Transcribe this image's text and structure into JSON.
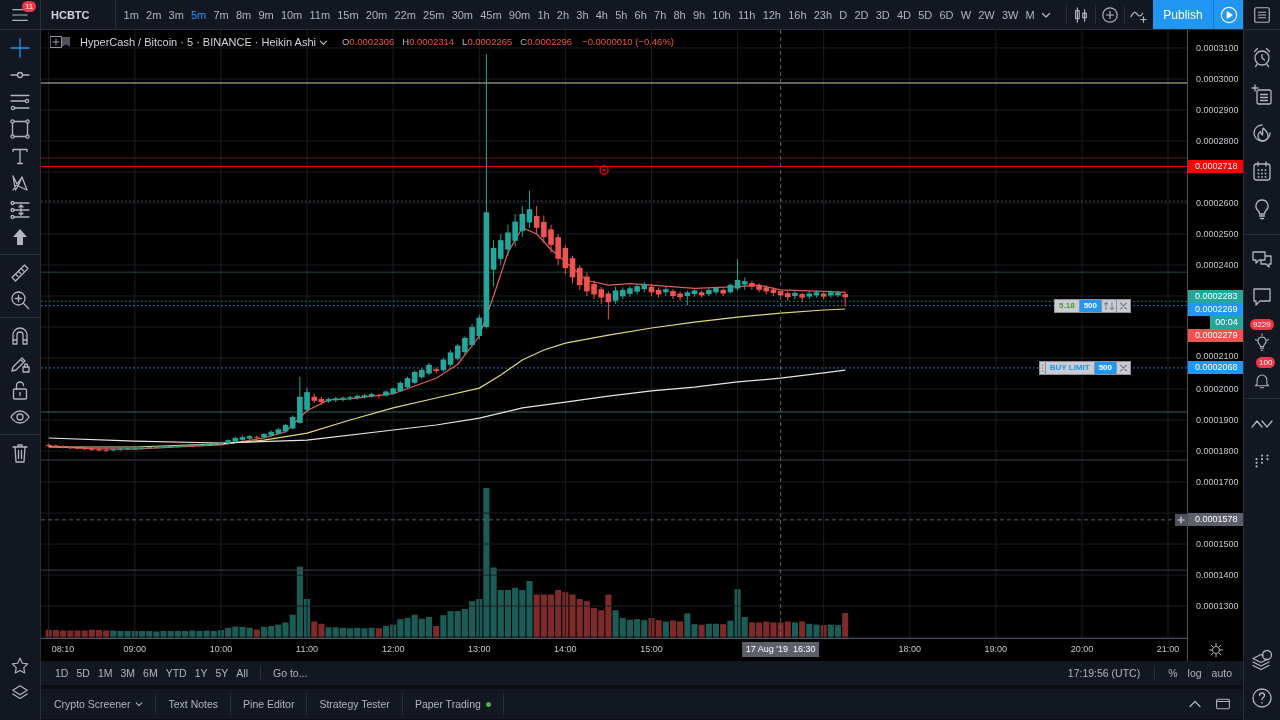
{
  "top_bar": {
    "menu_badge": "11",
    "symbol": "HCBTC",
    "intervals": [
      {
        "label": "1m",
        "selected": false
      },
      {
        "label": "2m",
        "selected": false
      },
      {
        "label": "3m",
        "selected": false
      },
      {
        "label": "5m",
        "selected": true
      },
      {
        "label": "7m",
        "selected": false
      },
      {
        "label": "8m",
        "selected": false
      },
      {
        "label": "9m",
        "selected": false
      },
      {
        "label": "10m",
        "selected": false
      },
      {
        "label": "11m",
        "selected": false
      },
      {
        "label": "15m",
        "selected": false
      },
      {
        "label": "20m",
        "selected": false
      },
      {
        "label": "22m",
        "selected": false
      },
      {
        "label": "25m",
        "selected": false
      },
      {
        "label": "30m",
        "selected": false
      },
      {
        "label": "45m",
        "selected": false
      },
      {
        "label": "90m",
        "selected": false
      },
      {
        "label": "1h",
        "selected": false
      },
      {
        "label": "2h",
        "selected": false
      },
      {
        "label": "3h",
        "selected": false
      },
      {
        "label": "4h",
        "selected": false
      },
      {
        "label": "5h",
        "selected": false
      },
      {
        "label": "6h",
        "selected": false
      },
      {
        "label": "7h",
        "selected": false
      },
      {
        "label": "8h",
        "selected": false
      },
      {
        "label": "9h",
        "selected": false
      },
      {
        "label": "10h",
        "selected": false
      },
      {
        "label": "11h",
        "selected": false
      },
      {
        "label": "12h",
        "selected": false
      },
      {
        "label": "16h",
        "selected": false
      },
      {
        "label": "23h",
        "selected": false
      },
      {
        "label": "D",
        "selected": false
      },
      {
        "label": "2D",
        "selected": false
      },
      {
        "label": "3D",
        "selected": false
      },
      {
        "label": "4D",
        "selected": false
      },
      {
        "label": "5D",
        "selected": false
      },
      {
        "label": "6D",
        "selected": false
      },
      {
        "label": "W",
        "selected": false
      },
      {
        "label": "2W",
        "selected": false
      },
      {
        "label": "3W",
        "selected": false
      },
      {
        "label": "M",
        "selected": false
      }
    ],
    "publish": "Publish"
  },
  "left_toolbar": {
    "tools": [
      {
        "selected": true
      },
      {
        "selected": false
      },
      {
        "selected": false
      },
      {
        "selected": false
      },
      {
        "selected": false
      },
      {
        "selected": false
      },
      {
        "selected": false
      },
      {
        "selected": false
      },
      {
        "selected": false
      },
      {
        "selected": false
      },
      {
        "selected": false
      },
      {
        "selected": false
      },
      {
        "selected": false
      },
      {
        "selected": false
      },
      {
        "selected": false
      }
    ]
  },
  "chart": {
    "legend": {
      "title": "HyperCash / Bitcoin · 5 · BINANCE · Heikin Ashi",
      "ohlc": [
        {
          "label": "O",
          "value": "0.0002306"
        },
        {
          "label": "H",
          "value": "0.0002314"
        },
        {
          "label": "L",
          "value": "0.0002265"
        },
        {
          "label": "C",
          "value": "0.0002296"
        }
      ],
      "change": "−0.0000010 (−0.46%)"
    },
    "line_widgets": [
      {
        "kind": "countdown",
        "text": "00:04"
      },
      {
        "kind": "position",
        "pnl": "5.18",
        "qty": "500"
      },
      {
        "kind": "order",
        "label": "BUY LIMIT",
        "qty": "500"
      }
    ],
    "price_tags": [
      {
        "price": "0.0002279",
        "color": "#ef5350"
      }
    ],
    "chart_data": [
      {
        "type": "candlestick",
        "x": [
          8,
          8.0833,
          8.1667,
          8.25,
          8.3333,
          8.4167,
          8.5,
          8.5833,
          8.6667,
          8.75,
          8.8333,
          8.9167,
          9,
          9.0833,
          9.1667,
          9.25,
          9.3333,
          9.4167,
          9.5,
          9.5833,
          9.6667,
          9.75,
          9.8333,
          9.9167,
          10,
          10.0833,
          10.1667,
          10.25,
          10.3333,
          10.4167,
          10.5,
          10.5833,
          10.6667,
          10.75,
          10.8333,
          10.9167,
          11,
          11.0833,
          11.1667,
          11.25,
          11.3333,
          11.4167,
          11.5,
          11.5833,
          11.6667,
          11.75,
          11.8333,
          11.9167,
          12,
          12.0833,
          12.1667,
          12.25,
          12.3333,
          12.4167,
          12.5,
          12.5833,
          12.6667,
          12.75,
          12.8333,
          12.9167,
          13,
          13.0833,
          13.1667,
          13.25,
          13.3333,
          13.4167,
          13.5,
          13.5833,
          13.6667,
          13.75,
          13.8333,
          13.9167,
          14,
          14.0833,
          14.1667,
          14.25,
          14.3333,
          14.4167,
          14.5,
          14.5833,
          14.6667,
          14.75,
          14.8333,
          14.9167,
          15,
          15.0833,
          15.1667,
          15.25,
          15.3333,
          15.4167,
          15.5,
          15.5833,
          15.6667,
          15.75,
          15.8333,
          15.9167,
          16,
          16.0833,
          16.1667,
          16.25,
          16.3333,
          16.4167,
          16.5,
          16.5833,
          16.6667,
          16.75,
          16.8333,
          16.9167,
          17,
          17.0833,
          17.1667,
          17.25
        ],
        "ohlc": [
          [
            0.000182,
            0.0001824,
            0.0001812,
            0.0001816
          ],
          [
            0.0001818,
            0.0001821,
            0.000181,
            0.0001813
          ],
          [
            0.0001815,
            0.0001818,
            0.0001808,
            0.0001811
          ],
          [
            0.0001813,
            0.0001816,
            0.0001806,
            0.0001809
          ],
          [
            0.0001811,
            0.0001815,
            0.0001805,
            0.0001808
          ],
          [
            0.000181,
            0.0001813,
            0.0001803,
            0.0001806
          ],
          [
            0.0001808,
            0.0001812,
            0.00018,
            0.0001804
          ],
          [
            0.0001806,
            0.000181,
            0.0001799,
            0.0001802
          ],
          [
            0.0001804,
            0.0001808,
            0.0001798,
            0.0001801
          ],
          [
            0.0001802,
            0.0001809,
            0.0001799,
            0.0001806
          ],
          [
            0.0001804,
            0.000181,
            0.0001801,
            0.0001808
          ],
          [
            0.0001806,
            0.0001812,
            0.0001803,
            0.000181
          ],
          [
            0.0001808,
            0.0001813,
            0.0001804,
            0.0001809
          ],
          [
            0.0001808,
            0.0001814,
            0.0001805,
            0.0001811
          ],
          [
            0.000181,
            0.0001815,
            0.0001806,
            0.0001812
          ],
          [
            0.0001811,
            0.0001816,
            0.0001808,
            0.0001814
          ],
          [
            0.0001812,
            0.0001818,
            0.0001809,
            0.0001815
          ],
          [
            0.0001814,
            0.0001819,
            0.000181,
            0.0001816
          ],
          [
            0.0001815,
            0.000182,
            0.0001811,
            0.0001817
          ],
          [
            0.0001816,
            0.0001821,
            0.0001812,
            0.0001818
          ],
          [
            0.0001817,
            0.0001823,
            0.0001813,
            0.000182
          ],
          [
            0.0001818,
            0.0001824,
            0.0001815,
            0.0001821
          ],
          [
            0.000182,
            0.0001826,
            0.0001816,
            0.0001823
          ],
          [
            0.0001821,
            0.0001827,
            0.0001818,
            0.0001824
          ],
          [
            0.0001823,
            0.000183,
            0.0001819,
            0.0001828
          ],
          [
            0.0001825,
            0.0001838,
            0.0001822,
            0.0001835
          ],
          [
            0.000183,
            0.0001846,
            0.0001827,
            0.0001842
          ],
          [
            0.0001836,
            0.000185,
            0.0001832,
            0.0001845
          ],
          [
            0.000184,
            0.0001852,
            0.0001836,
            0.0001848
          ],
          [
            0.0001846,
            0.000185,
            0.0001838,
            0.0001843
          ],
          [
            0.0001844,
            0.0001858,
            0.000184,
            0.0001855
          ],
          [
            0.000185,
            0.0001866,
            0.0001846,
            0.0001862
          ],
          [
            0.0001856,
            0.0001875,
            0.0001852,
            0.000187
          ],
          [
            0.0001863,
            0.0001888,
            0.000186,
            0.0001884
          ],
          [
            0.0001873,
            0.0001915,
            0.000187,
            0.000191
          ],
          [
            0.0001891,
            0.000204,
            0.0001888,
            0.0001975
          ],
          [
            0.0001933,
            0.0002005,
            0.0001925,
            0.000199
          ],
          [
            0.0001975,
            0.0001985,
            0.0001955,
            0.0001962
          ],
          [
            0.0001968,
            0.0001975,
            0.000195,
            0.0001958
          ],
          [
            0.000196,
            0.0001972,
            0.0001955,
            0.0001968
          ],
          [
            0.0001964,
            0.0001975,
            0.0001958,
            0.000197
          ],
          [
            0.0001967,
            0.0001976,
            0.000196,
            0.0001972
          ],
          [
            0.0001969,
            0.0001978,
            0.0001963,
            0.0001974
          ],
          [
            0.0001971,
            0.0001982,
            0.0001966,
            0.0001978
          ],
          [
            0.0001974,
            0.0001984,
            0.0001969,
            0.000198
          ],
          [
            0.0001977,
            0.0001988,
            0.0001972,
            0.0001984
          ],
          [
            0.0001981,
            0.0001985,
            0.000197,
            0.0001978
          ],
          [
            0.0001979,
            0.0001995,
            0.0001975,
            0.0001992
          ],
          [
            0.0001985,
            0.0002005,
            0.0001982,
            0.0002002
          ],
          [
            0.0001993,
            0.0002025,
            0.000199,
            0.000202
          ],
          [
            0.0002006,
            0.000204,
            0.0002002,
            0.0002035
          ],
          [
            0.000202,
            0.000206,
            0.0002015,
            0.0002055
          ],
          [
            0.0002038,
            0.0002068,
            0.0002032,
            0.0002062
          ],
          [
            0.000205,
            0.0002085,
            0.0002045,
            0.0002078
          ],
          [
            0.0002064,
            0.000207,
            0.000205,
            0.0002058
          ],
          [
            0.0002061,
            0.00021,
            0.0002056,
            0.0002095
          ],
          [
            0.0002078,
            0.0002125,
            0.0002072,
            0.0002118
          ],
          [
            0.0002098,
            0.0002145,
            0.0002092,
            0.000214
          ],
          [
            0.0002119,
            0.000217,
            0.0002112,
            0.0002165
          ],
          [
            0.0002142,
            0.000221,
            0.0002135,
            0.00022
          ],
          [
            0.0002171,
            0.000224,
            0.000216,
            0.000223
          ],
          [
            0.00022,
            0.000308,
            0.0002195,
            0.000257
          ],
          [
            0.0002385,
            0.000248,
            0.000233,
            0.0002455
          ],
          [
            0.000242,
            0.00025,
            0.00024,
            0.000248
          ],
          [
            0.000245,
            0.000253,
            0.000243,
            0.0002505
          ],
          [
            0.0002478,
            0.0002565,
            0.000246,
            0.000254
          ],
          [
            0.0002509,
            0.000259,
            0.000249,
            0.0002565
          ],
          [
            0.0002537,
            0.000264,
            0.000252,
            0.000258
          ],
          [
            0.0002558,
            0.000259,
            0.00025,
            0.000252
          ],
          [
            0.0002539,
            0.000256,
            0.000247,
            0.000249
          ],
          [
            0.0002515,
            0.000253,
            0.000244,
            0.0002465
          ],
          [
            0.000249,
            0.00025,
            0.00024,
            0.000242
          ],
          [
            0.0002455,
            0.0002465,
            0.000237,
            0.000239
          ],
          [
            0.0002422,
            0.000243,
            0.000234,
            0.000236
          ],
          [
            0.0002391,
            0.00024,
            0.000232,
            0.0002335
          ],
          [
            0.0002363,
            0.0002375,
            0.00023,
            0.0002315
          ],
          [
            0.0002339,
            0.000235,
            0.000229,
            0.0002305
          ],
          [
            0.0002322,
            0.000233,
            0.0002275,
            0.0002295
          ],
          [
            0.0002308,
            0.0002315,
            0.0002225,
            0.000228
          ],
          [
            0.0002285,
            0.000233,
            0.0002275,
            0.0002318
          ],
          [
            0.0002299,
            0.0002328,
            0.000229,
            0.000232
          ],
          [
            0.0002307,
            0.0002332,
            0.0002298,
            0.0002325
          ],
          [
            0.0002314,
            0.000234,
            0.0002305,
            0.0002332
          ],
          [
            0.0002322,
            0.0002345,
            0.0002312,
            0.0002338
          ],
          [
            0.000233,
            0.0002338,
            0.00023,
            0.0002312
          ],
          [
            0.000232,
            0.0002328,
            0.0002295,
            0.0002305
          ],
          [
            0.0002312,
            0.000233,
            0.00023,
            0.0002322
          ],
          [
            0.0002316,
            0.0002322,
            0.000229,
            0.00023
          ],
          [
            0.0002308,
            0.0002315,
            0.0002285,
            0.0002296
          ],
          [
            0.00023,
            0.0002318,
            0.000227,
            0.0002312
          ],
          [
            0.0002306,
            0.0002322,
            0.0002298,
            0.0002318
          ],
          [
            0.0002312,
            0.0002318,
            0.0002295,
            0.0002302
          ],
          [
            0.0002306,
            0.0002325,
            0.00023,
            0.000232
          ],
          [
            0.0002312,
            0.000233,
            0.0002305,
            0.0002326
          ],
          [
            0.000232,
            0.0002324,
            0.00023,
            0.0002308
          ],
          [
            0.0002312,
            0.000234,
            0.0002308,
            0.0002336
          ],
          [
            0.0002324,
            0.000242,
            0.0002318,
            0.0002352
          ],
          [
            0.0002337,
            0.000236,
            0.000232,
            0.0002348
          ],
          [
            0.0002342,
            0.0002348,
            0.000232,
            0.000233
          ],
          [
            0.0002335,
            0.000234,
            0.0002312,
            0.000232
          ],
          [
            0.0002328,
            0.0002335,
            0.0002305,
            0.0002315
          ],
          [
            0.0002321,
            0.0002328,
            0.00023,
            0.000231
          ],
          [
            0.0002316,
            0.000232,
            0.0002292,
            0.0002302
          ],
          [
            0.0002309,
            0.0002315,
            0.0002285,
            0.0002296
          ],
          [
            0.00023,
            0.0002318,
            0.000229,
            0.000231
          ],
          [
            0.0002306,
            0.000231,
            0.000228,
            0.0002295
          ],
          [
            0.0002298,
            0.0002315,
            0.000229,
            0.0002308
          ],
          [
            0.0002302,
            0.0002318,
            0.0002295,
            0.0002312
          ],
          [
            0.0002308,
            0.0002312,
            0.000229,
            0.0002298
          ],
          [
            0.0002302,
            0.0002318,
            0.0002295,
            0.0002312
          ],
          [
            0.0002302,
            0.0002318,
            0.0002296,
            0.0002312
          ],
          [
            0.0002306,
            0.0002314,
            0.0002265,
            0.0002296
          ]
        ],
        "series": [
          {
            "type": "line",
            "color": "#e35d5d",
            "x": [
              8,
              8.5,
              9,
              9.5,
              10,
              10.5,
              10.75,
              11,
              11.25,
              11.5,
              12,
              12.5,
              12.75,
              13,
              13.1667,
              13.3333,
              13.5,
              13.6667,
              13.8333,
              14,
              14.25,
              14.5,
              14.75,
              15,
              15.5,
              16,
              16.25,
              16.5,
              17,
              17.25
            ],
            "values": [
              0.0001815,
              0.0001808,
              0.0001806,
              0.0001813,
              0.000182,
              0.0001842,
              0.0001862,
              0.000193,
              0.0001965,
              0.0001968,
              0.0001985,
              0.0002035,
              0.000208,
              0.000217,
              0.00023,
              0.000244,
              0.000252,
              0.00025,
              0.000245,
              0.000241,
              0.000235,
              0.0002335,
              0.000234,
              0.0002335,
              0.0002325,
              0.000233,
              0.0002335,
              0.000232,
              0.0002315,
              0.0002312
            ]
          },
          {
            "type": "line",
            "color": "#e3d77a",
            "x": [
              8,
              9,
              10,
              10.5,
              11,
              11.5,
              12,
              12.5,
              13,
              13.25,
              13.5,
              13.75,
              14,
              14.5,
              15,
              15.5,
              16,
              16.5,
              17,
              17.25
            ],
            "values": [
              0.0001813,
              0.0001813,
              0.0001823,
              0.0001835,
              0.0001858,
              0.00019,
              0.0001939,
              0.0001971,
              0.0002003,
              0.0002045,
              0.0002094,
              0.0002126,
              0.0002148,
              0.0002174,
              0.0002197,
              0.0002216,
              0.0002232,
              0.0002245,
              0.0002255,
              0.0002258
            ]
          },
          {
            "type": "line",
            "color": "#e8e6df",
            "x": [
              8,
              9,
              10,
              11,
              12,
              12.5,
              13,
              13.5,
              14,
              14.5,
              15,
              15.5,
              16,
              16.5,
              17,
              17.25
            ],
            "values": [
              0.0001842,
              0.0001832,
              0.0001826,
              0.0001835,
              0.0001868,
              0.0001884,
              0.0001906,
              0.0001939,
              0.0001958,
              0.0001977,
              0.0001994,
              0.0002006,
              0.0002023,
              0.0002035,
              0.0002052,
              0.0002061
            ]
          }
        ],
        "xlim": [
          7.91,
          21.22
        ],
        "ylim": [
          0.0001197,
          0.0003158
        ],
        "xticks": [
          {
            "value": 8.1667,
            "label": "08:10"
          },
          {
            "value": 9,
            "label": "09:00"
          },
          {
            "value": 10,
            "label": "10:00"
          },
          {
            "value": 11,
            "label": "11:00"
          },
          {
            "value": 12,
            "label": "12:00"
          },
          {
            "value": 13,
            "label": "13:00"
          },
          {
            "value": 14,
            "label": "14:00"
          },
          {
            "value": 15,
            "label": "15:00"
          },
          {
            "value": 18,
            "label": "18:00"
          },
          {
            "value": 19,
            "label": "19:00"
          },
          {
            "value": 20,
            "label": "20:00"
          },
          {
            "value": 21,
            "label": "21:00"
          }
        ],
        "yticks": [
          {
            "value": 0.00013,
            "label": "0.0001300"
          },
          {
            "value": 0.00014,
            "label": "0.0001400"
          },
          {
            "value": 0.00015,
            "label": "0.0001500"
          },
          {
            "value": 0.00017,
            "label": "0.0001700"
          },
          {
            "value": 0.00018,
            "label": "0.0001800"
          },
          {
            "value": 0.00019,
            "label": "0.0001900"
          },
          {
            "value": 0.0002,
            "label": "0.0002000"
          },
          {
            "value": 0.00021,
            "label": "0.0002100"
          },
          {
            "value": 0.00024,
            "label": "0.0002400"
          },
          {
            "value": 0.00025,
            "label": "0.0002500"
          },
          {
            "value": 0.00026,
            "label": "0.0002600"
          },
          {
            "value": 0.00028,
            "label": "0.0002800"
          },
          {
            "value": 0.00029,
            "label": "0.0002900"
          },
          {
            "value": 0.0003,
            "label": "0.0003000"
          },
          {
            "value": 0.00031,
            "label": "0.0003100"
          }
        ],
        "ref_lines": [
          {
            "axis": "y",
            "value": 0.0002987,
            "color": "#cfc3a0"
          },
          {
            "axis": "y",
            "value": 0.0002745,
            "color": "#5e1b1b"
          },
          {
            "axis": "y",
            "value": 0.0002718,
            "label": "0.0002718",
            "color": "#ff0000"
          },
          {
            "axis": "y",
            "value": 0.0002606,
            "color": "#5d6068",
            "line_style": "dotted"
          },
          {
            "axis": "y",
            "value": 0.0002377,
            "color": "#1e4a4a"
          },
          {
            "axis": "y",
            "value": 0.0002283,
            "label": "0.0002283",
            "color": "#26a69a",
            "line_style": "dotted"
          },
          {
            "axis": "y",
            "value": 0.0002269,
            "label": "0.0002269",
            "color": "#2196f3",
            "line_style": "dotted"
          },
          {
            "axis": "y",
            "value": 0.0002068,
            "label": "0.0002068",
            "color": "#2196f3",
            "line_style": "dotted"
          },
          {
            "axis": "y",
            "value": 0.0001926,
            "color": "#2a6b66"
          },
          {
            "axis": "y",
            "value": 0.0001771,
            "color": "#3b3f49"
          },
          {
            "axis": "y",
            "value": 0.0001416,
            "color": "#3b3f49"
          },
          {
            "axis": "y",
            "value": 0.0001578,
            "label": "0.0001578",
            "color": "#5d606b",
            "line_style": "dashed"
          },
          {
            "axis": "x",
            "value": 16.5,
            "label": "17 Aug '19  16:30",
            "color": "#5d606b",
            "line_style": "dashed"
          }
        ],
        "grid": true
      }
    ]
  },
  "right_sidebar": {
    "badges": [
      "9229",
      "100"
    ]
  },
  "range_bar": {
    "ranges": [
      {
        "label": "1D",
        "selected": false
      },
      {
        "label": "5D",
        "selected": false
      },
      {
        "label": "1M",
        "selected": false
      },
      {
        "label": "3M",
        "selected": false
      },
      {
        "label": "6M",
        "selected": false
      },
      {
        "label": "YTD",
        "selected": false
      },
      {
        "label": "1Y",
        "selected": false
      },
      {
        "label": "5Y",
        "selected": false
      },
      {
        "label": "All",
        "selected": false
      }
    ],
    "goto": "Go to...",
    "clock": "17:19:56 (UTC)",
    "scales": [
      {
        "label": "%",
        "selected": false
      },
      {
        "label": "log",
        "selected": false
      },
      {
        "label": "auto",
        "selected": false
      }
    ]
  },
  "bottom_tabs": [
    {
      "label": "Crypto Screener",
      "dropdown": true,
      "selected": false
    },
    {
      "label": "Text Notes",
      "dropdown": false,
      "selected": false
    },
    {
      "label": "Pine Editor",
      "dropdown": false,
      "selected": false
    },
    {
      "label": "Strategy Tester",
      "dropdown": false,
      "selected": false
    },
    {
      "label": "Paper Trading",
      "dropdown": false,
      "selected": false,
      "color": "#4caf50"
    }
  ]
}
